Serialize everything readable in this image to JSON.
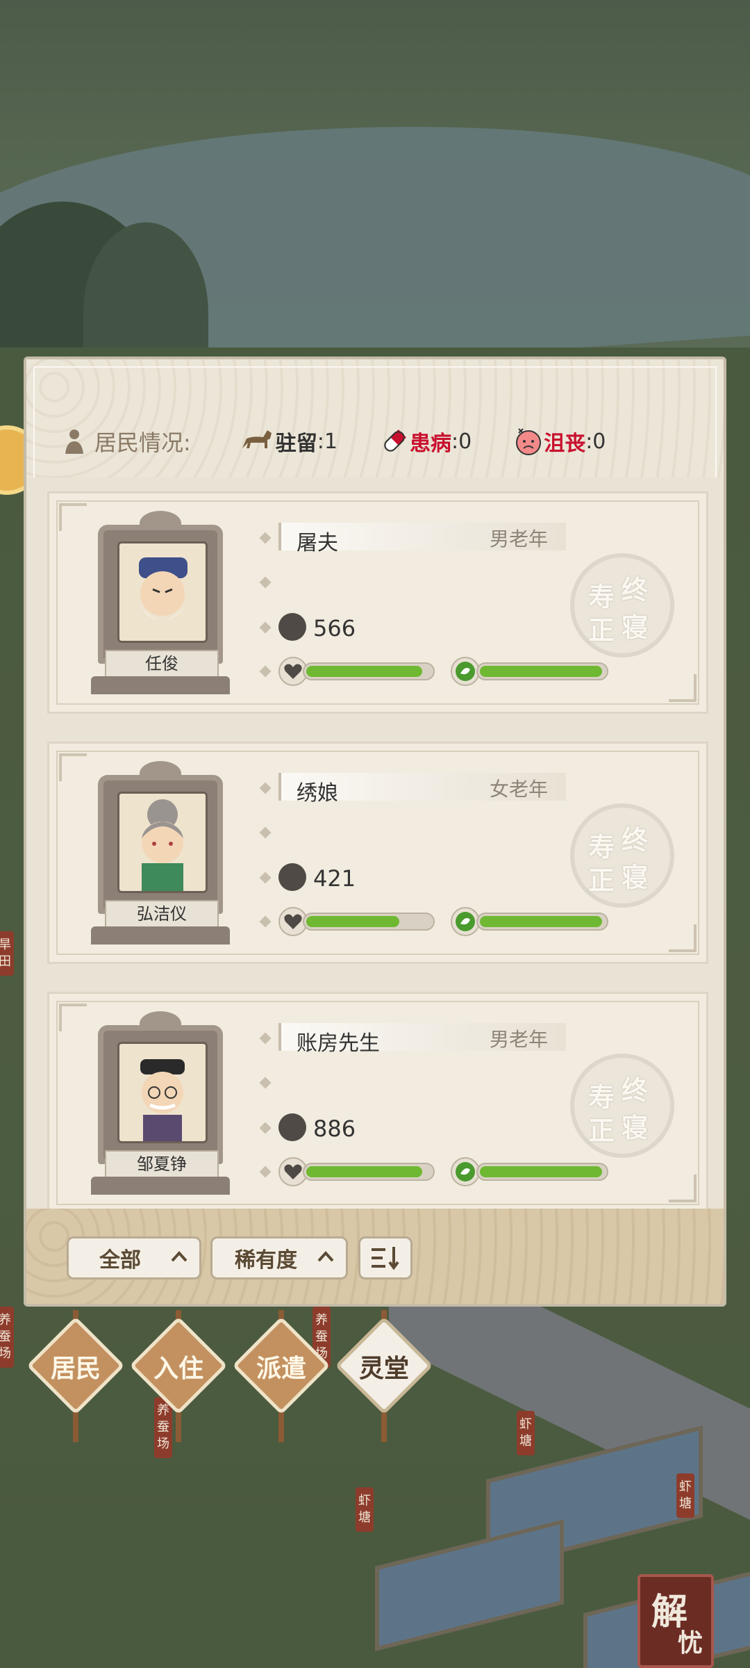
{
  "status": {
    "label": "居民情况:",
    "stationed_label": "驻留",
    "stationed_value": ":1",
    "sick_label": "患病",
    "sick_value": ":0",
    "depressed_label": "沮丧",
    "depressed_value": ":0"
  },
  "residents": [
    {
      "name": "任俊",
      "job": "屠夫",
      "class": "男老年",
      "value": "566",
      "health": 0.93,
      "mood": 0.98,
      "stamp": [
        "寿",
        "终",
        "正",
        "寝"
      ]
    },
    {
      "name": "弘洁仪",
      "job": "绣娘",
      "class": "女老年",
      "value": "421",
      "health": 0.75,
      "mood": 0.98,
      "stamp": [
        "寿",
        "终",
        "正",
        "寝"
      ]
    },
    {
      "name": "邹夏铮",
      "job": "账房先生",
      "class": "男老年",
      "value": "886",
      "health": 0.93,
      "mood": 0.98,
      "stamp": [
        "寿",
        "终",
        "正",
        "寝"
      ]
    }
  ],
  "filters": {
    "all": "全部",
    "rarity": "稀有度",
    "sort_icon": "三"
  },
  "nav": [
    {
      "label": "居民",
      "active": false
    },
    {
      "label": "入住",
      "active": false
    },
    {
      "label": "派遣",
      "active": false
    },
    {
      "label": "灵堂",
      "active": true
    }
  ],
  "map_labels": {
    "left_tag1": "旱田",
    "left_tag2": "养蚕场",
    "mid_tag1": "养蚕场",
    "mid_tag2": "养蚕场",
    "shrimp1": "虾塘",
    "shrimp2": "虾塘",
    "shrimp3": "虾塘"
  },
  "seal": {
    "a": "解",
    "b": "忧"
  },
  "colors": {
    "bar_fill": "#6fb832",
    "sick": "#c8102e",
    "depressed": "#c8102e"
  }
}
